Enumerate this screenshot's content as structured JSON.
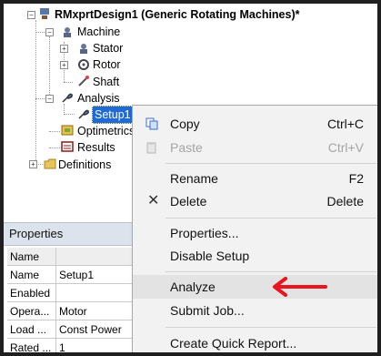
{
  "tree": {
    "root": "RMxprtDesign1 (Generic Rotating Machines)*",
    "machine": "Machine",
    "stator": "Stator",
    "rotor": "Rotor",
    "shaft": "Shaft",
    "analysis": "Analysis",
    "setup": "Setup1",
    "optimetrics": "Optimetrics",
    "results": "Results",
    "definitions": "Definitions"
  },
  "properties": {
    "title": "Properties",
    "header": "Name",
    "rows": [
      {
        "key": "Name",
        "value": "Setup1"
      },
      {
        "key": "Enabled",
        "value": ""
      },
      {
        "key": "Opera...",
        "value": "Motor"
      },
      {
        "key": "Load ...",
        "value": "Const Power"
      },
      {
        "key": "Rated ...",
        "value": "1"
      }
    ]
  },
  "menu": {
    "copy": {
      "label": "Copy",
      "shortcut": "Ctrl+C"
    },
    "paste": {
      "label": "Paste",
      "shortcut": "Ctrl+V"
    },
    "rename": {
      "label": "Rename",
      "shortcut": "F2"
    },
    "delete": {
      "label": "Delete",
      "shortcut": "Delete"
    },
    "properties": {
      "label": "Properties..."
    },
    "disable_setup": {
      "label": "Disable Setup"
    },
    "analyze": {
      "label": "Analyze"
    },
    "submit_job": {
      "label": "Submit Job..."
    },
    "quick_report": {
      "label": "Create Quick Report..."
    }
  },
  "colors": {
    "selection": "#1e6ad6",
    "arrow": "#e8141e",
    "menu_bg": "#f2f2f2",
    "highlight": "#e3e3e3"
  }
}
